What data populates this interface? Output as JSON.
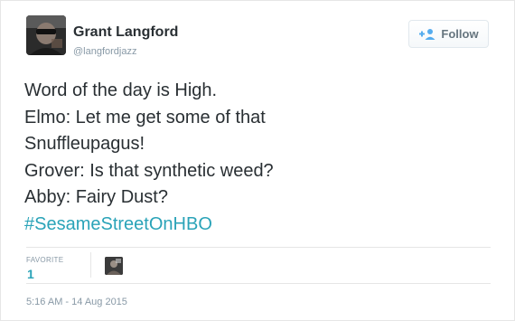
{
  "author": {
    "display_name": "Grant Langford",
    "username": "@langfordjazz"
  },
  "follow_button": {
    "label": "Follow",
    "icon": "add-user-icon"
  },
  "tweet": {
    "lines": [
      "Word of the day is High.",
      "Elmo: Let me get some of that",
      "Snuffleupagus!",
      "Grover: Is that synthetic weed?",
      "Abby: Fairy Dust?"
    ],
    "hashtag": "#SesameStreetOnHBO"
  },
  "stats": {
    "favorite_label": "FAVORITE",
    "favorite_count": "1"
  },
  "timestamp": "5:16 AM - 14 Aug 2015",
  "colors": {
    "text": "#292f33",
    "muted": "#8899a6",
    "link": "#2aa3b8",
    "divider": "#e6e6e6"
  }
}
